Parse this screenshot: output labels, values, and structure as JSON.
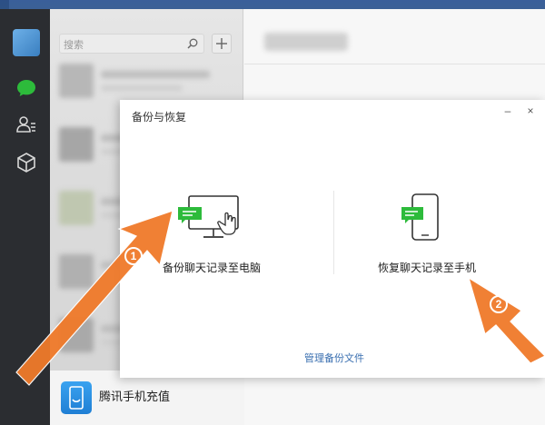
{
  "sidebar": {
    "icons": [
      "avatar",
      "chat-bubble-icon",
      "contacts-icon",
      "cube-icon"
    ]
  },
  "chat_list": {
    "search_placeholder": "搜索",
    "add_label": "+",
    "bottom_item_label": "腾讯手机充值"
  },
  "dialog": {
    "title": "备份与恢复",
    "minimize_label": "–",
    "close_label": "×",
    "backup_label": "备份聊天记录至电脑",
    "restore_label": "恢复聊天记录至手机",
    "manage_label": "管理备份文件"
  },
  "annotations": {
    "step1": "1",
    "step2": "2",
    "arrow_color": "#f07a2a"
  },
  "colors": {
    "accent_green": "#2dbb3b",
    "link_blue": "#3a6fb0",
    "nav_dark": "#2b2d31"
  }
}
